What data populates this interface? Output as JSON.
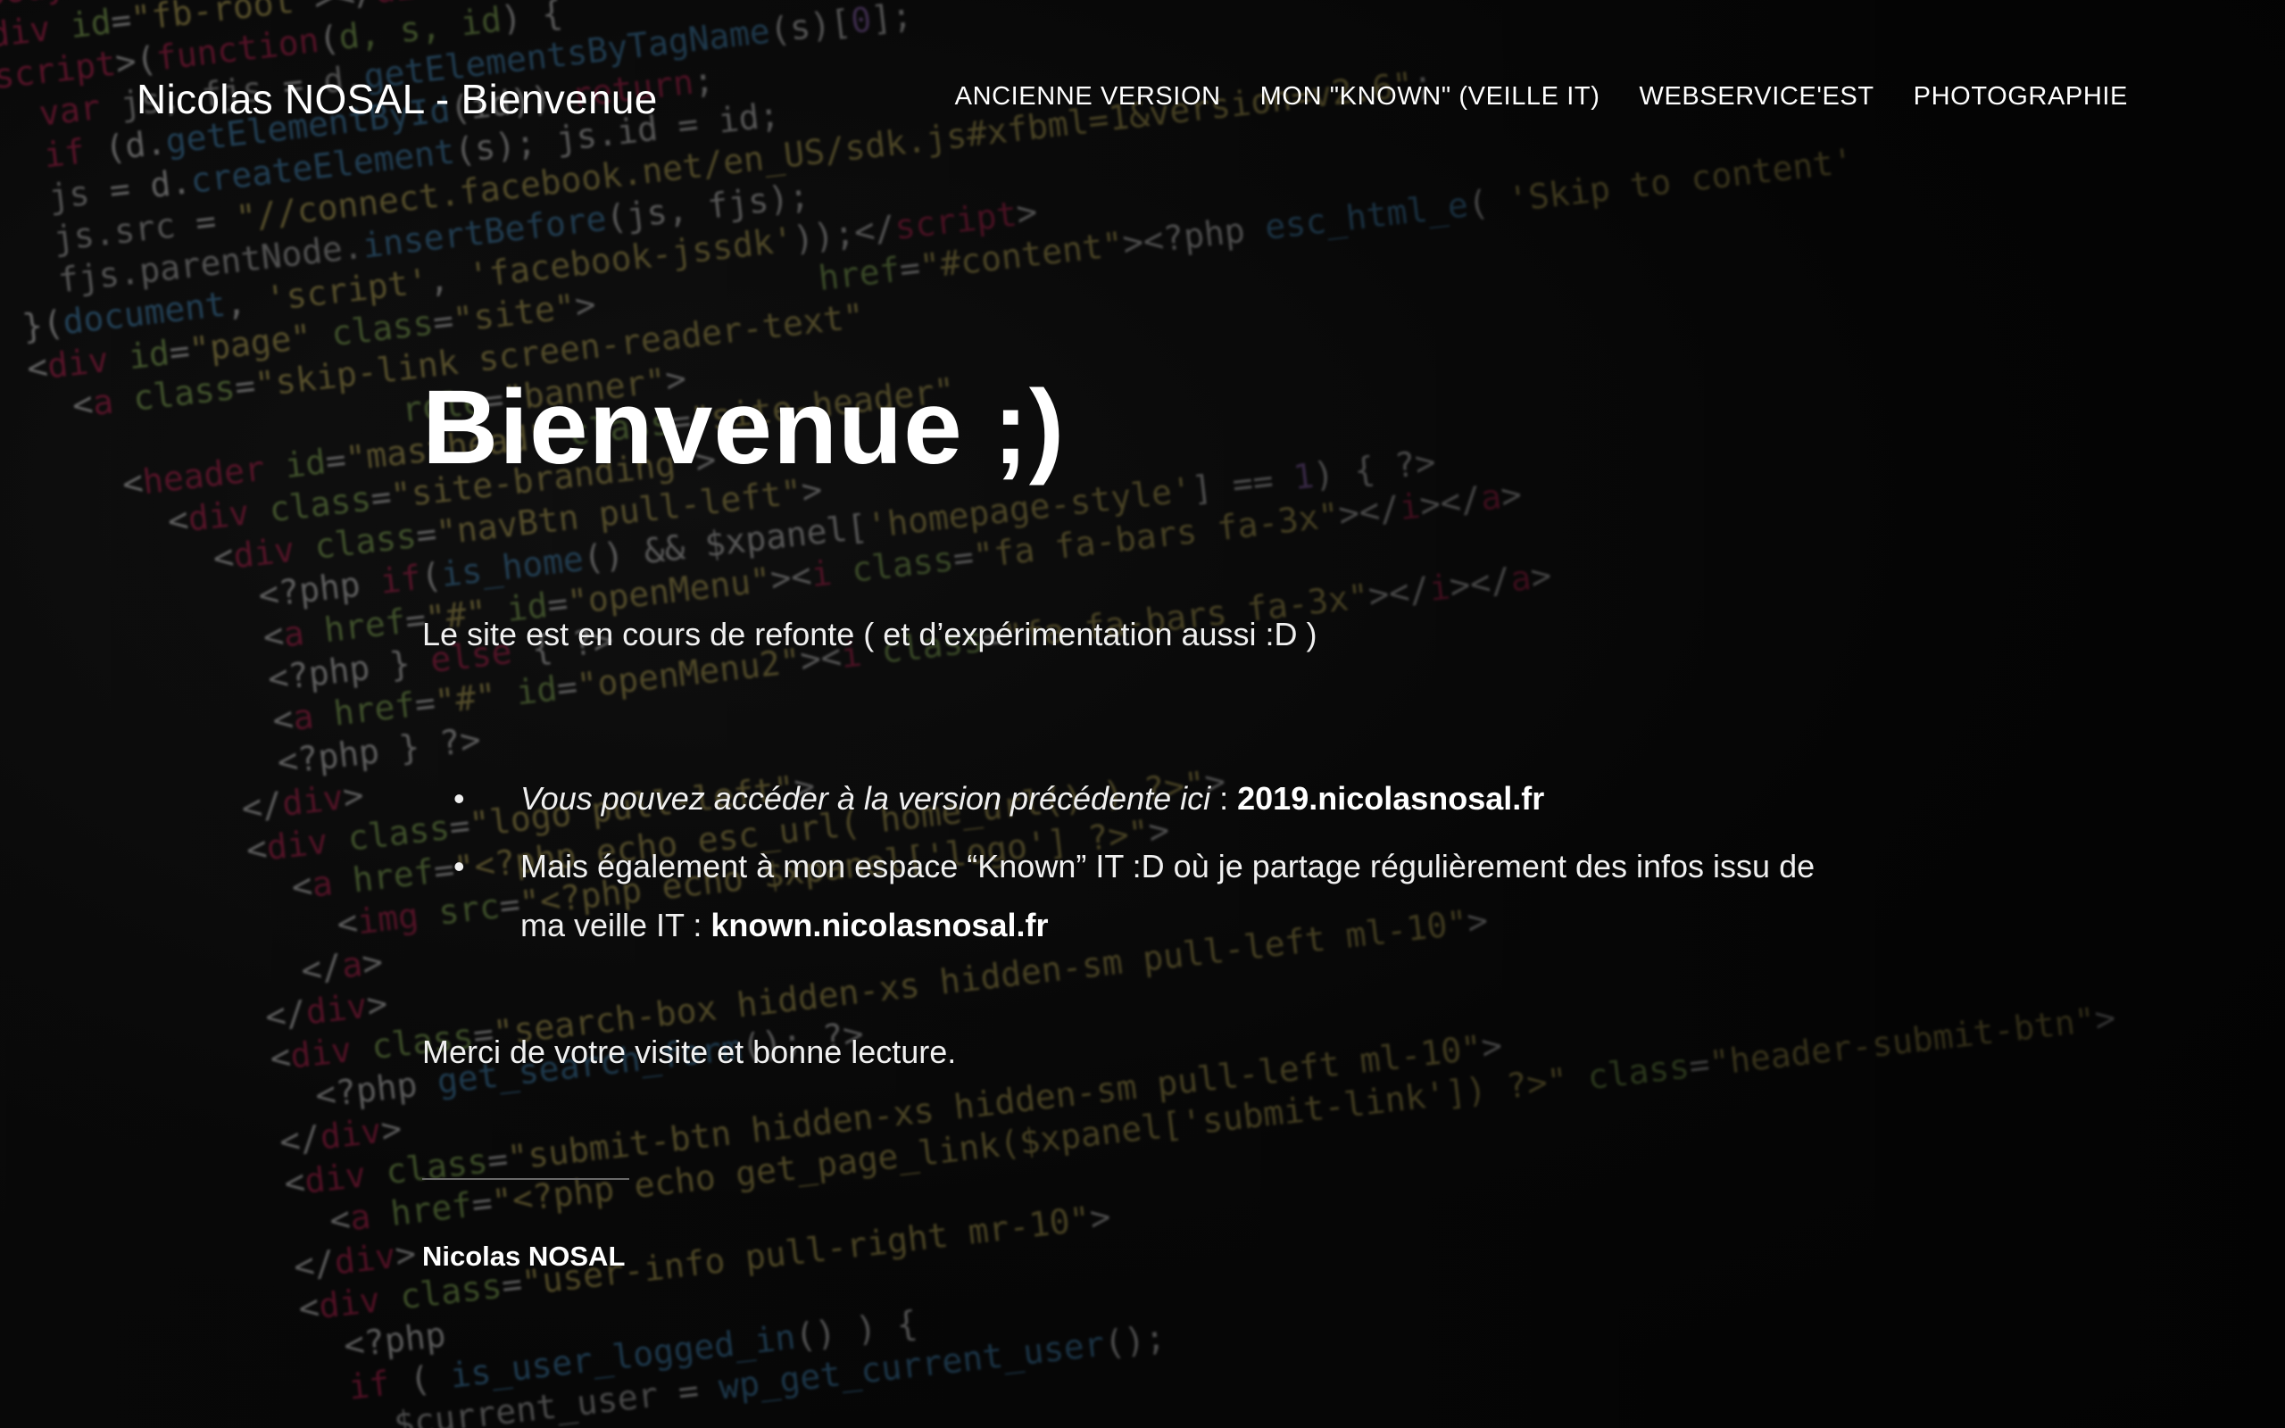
{
  "site": {
    "title": "Nicolas NOSAL - Bienvenue"
  },
  "nav": {
    "items": [
      {
        "label": "ANCIENNE VERSION"
      },
      {
        "label": "MON \"KNOWN\" (VEILLE IT)"
      },
      {
        "label": "WEBSERVICE'EST"
      },
      {
        "label": "PHOTOGRAPHIE"
      }
    ]
  },
  "main": {
    "hero": "Bienvenue ;)",
    "intro": "Le site est en cours de refonte ( et d’expérimentation aussi :D )",
    "items": [
      {
        "bullet": "•",
        "italic": "Vous pouvez accéder à la version précédente ici",
        "separator": " : ",
        "link": "2019.nicolasnosal.fr"
      },
      {
        "bullet": "•",
        "text": "Mais également à mon espace “Known” IT :D où je partage régulièrement des infos issu de ma veille IT : ",
        "link": "known.nicolasnosal.fr"
      }
    ],
    "thanks": "Merci de votre visite et bonne lecture.",
    "author": "Nicolas NOSAL"
  },
  "colors": {
    "background": "#0b0b0b",
    "text": "#ffffff",
    "code_tag": "#e0245e",
    "code_attr": "#a6d86a",
    "code_string": "#e8d26a",
    "code_function": "#4fa3e0"
  }
}
